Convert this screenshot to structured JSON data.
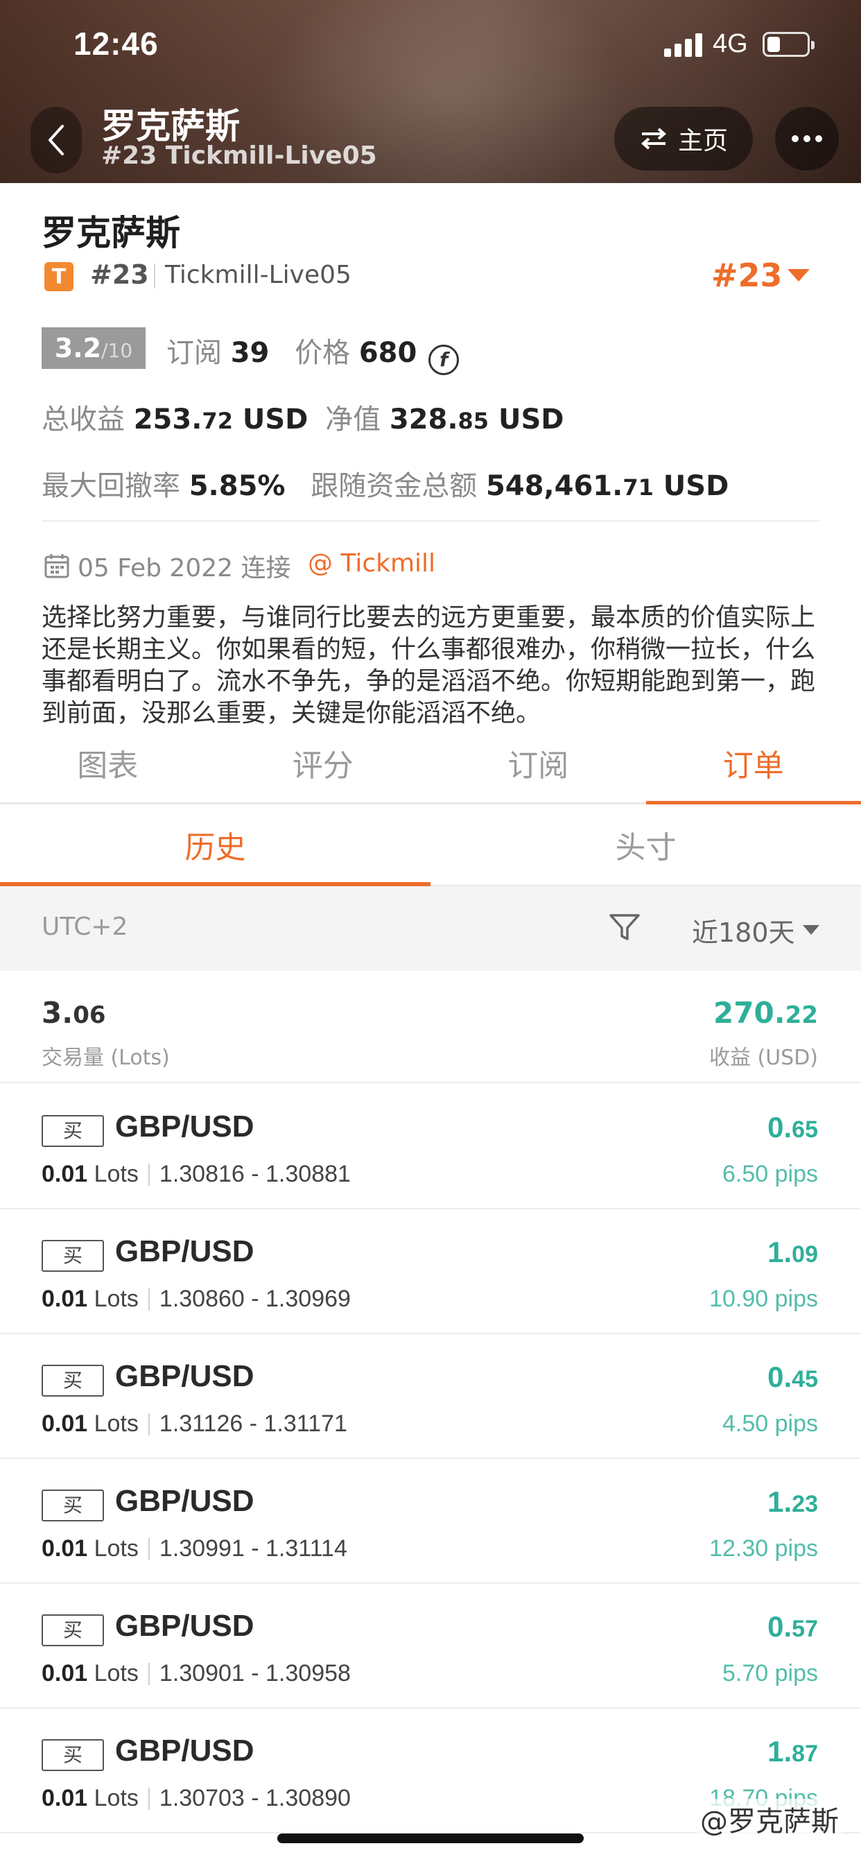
{
  "status_bar": {
    "time": "12:46",
    "network": "4G"
  },
  "nav": {
    "title": "罗克萨斯",
    "subtitle": "#23 Tickmill-Live05",
    "home_label": "主页"
  },
  "profile": {
    "name": "罗克萨斯",
    "badge": "T",
    "rank": "#23",
    "server": "Tickmill-Live05",
    "rank_big": "#23",
    "score": "3.2",
    "score_max": "/10",
    "subscribe_label": "订阅",
    "subscribe_count": "39",
    "price_label": "价格",
    "price_value": "680",
    "coin_symbol": "f",
    "total_profit_label": "总收益",
    "total_profit_int": "253.",
    "total_profit_dec": "72",
    "total_profit_unit": "USD",
    "equity_label": "净值",
    "equity_int": "328.",
    "equity_dec": "85",
    "equity_unit": "USD",
    "max_drawdown_label": "最大回撤率",
    "max_drawdown_value": "5.85%",
    "follow_funds_label": "跟随资金总额",
    "follow_funds_int": "548,461.",
    "follow_funds_dec": "71",
    "follow_funds_unit": "USD",
    "connected_since": "05 Feb 2022 连接",
    "broker": "@ Tickmill",
    "bio": "选择比努力重要，与谁同行比要去的远方更重要，最本质的价值实际上还是长期主义。你如果看的短，什么事都很难办，你稍微一拉长，什么事都看明白了。流水不争先，争的是滔滔不绝。你短期能跑到第一，跑到前面，没那么重要，关键是你能滔滔不绝。"
  },
  "tabs": [
    {
      "label": "图表"
    },
    {
      "label": "评分"
    },
    {
      "label": "订阅"
    },
    {
      "label": "订单"
    }
  ],
  "subtabs": [
    {
      "label": "历史"
    },
    {
      "label": "头寸"
    }
  ],
  "filter": {
    "timezone": "UTC+2",
    "period": "近180天"
  },
  "summary": {
    "lots_int": "3.",
    "lots_dec": "06",
    "lots_label": "交易量 (Lots)",
    "profit_int": "270.",
    "profit_dec": "22",
    "profit_label": "收益 (USD)"
  },
  "orders": [
    {
      "side": "买",
      "symbol": "GBP/USD",
      "lots": "0.01",
      "lots_unit": "Lots",
      "range": "1.30816 - 1.30881",
      "profit_int": "0.",
      "profit_dec": "65",
      "pips": "6.50 pips"
    },
    {
      "side": "买",
      "symbol": "GBP/USD",
      "lots": "0.01",
      "lots_unit": "Lots",
      "range": "1.30860 - 1.30969",
      "profit_int": "1.",
      "profit_dec": "09",
      "pips": "10.90 pips"
    },
    {
      "side": "买",
      "symbol": "GBP/USD",
      "lots": "0.01",
      "lots_unit": "Lots",
      "range": "1.31126 - 1.31171",
      "profit_int": "0.",
      "profit_dec": "45",
      "pips": "4.50 pips"
    },
    {
      "side": "买",
      "symbol": "GBP/USD",
      "lots": "0.01",
      "lots_unit": "Lots",
      "range": "1.30991 - 1.31114",
      "profit_int": "1.",
      "profit_dec": "23",
      "pips": "12.30 pips"
    },
    {
      "side": "买",
      "symbol": "GBP/USD",
      "lots": "0.01",
      "lots_unit": "Lots",
      "range": "1.30901 - 1.30958",
      "profit_int": "0.",
      "profit_dec": "57",
      "pips": "5.70 pips"
    },
    {
      "side": "买",
      "symbol": "GBP/USD",
      "lots": "0.01",
      "lots_unit": "Lots",
      "range": "1.30703 - 1.30890",
      "profit_int": "1.",
      "profit_dec": "87",
      "pips": "18.70 pips"
    }
  ],
  "watermark": "@罗克萨斯",
  "colors": {
    "accent": "#ee6d2a",
    "profit": "#2eaf99"
  }
}
